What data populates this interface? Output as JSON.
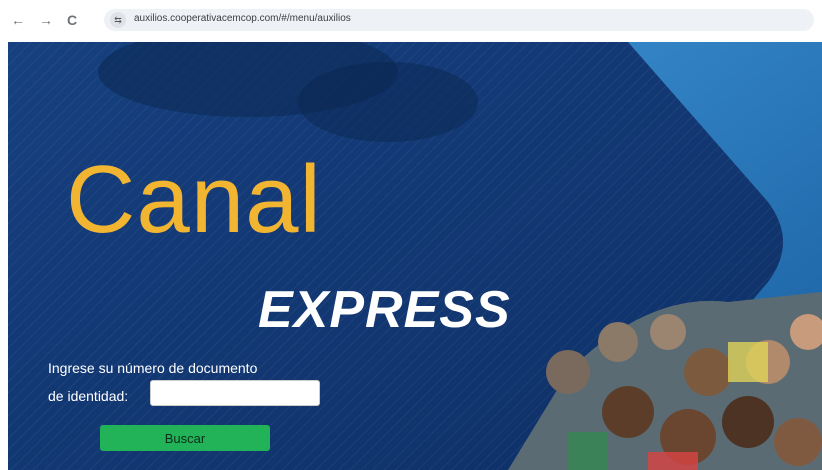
{
  "browser": {
    "back_icon": "←",
    "forward_icon": "→",
    "reload_icon": "C",
    "site_info_icon": "⇆",
    "url": "auxilios.cooperativacemcop.com/#/menu/auxilios"
  },
  "hero": {
    "title": "Canal",
    "subtitle": "EXPRESS"
  },
  "form": {
    "prompt_line1": "Ingrese su número de documento",
    "prompt_line2": "de identidad:",
    "input_value": "",
    "button_label": "Buscar"
  },
  "colors": {
    "navy": "#123a78",
    "blue_band": "#2f7fc0",
    "accent_yellow": "#f2b531",
    "button_green": "#22b359"
  }
}
